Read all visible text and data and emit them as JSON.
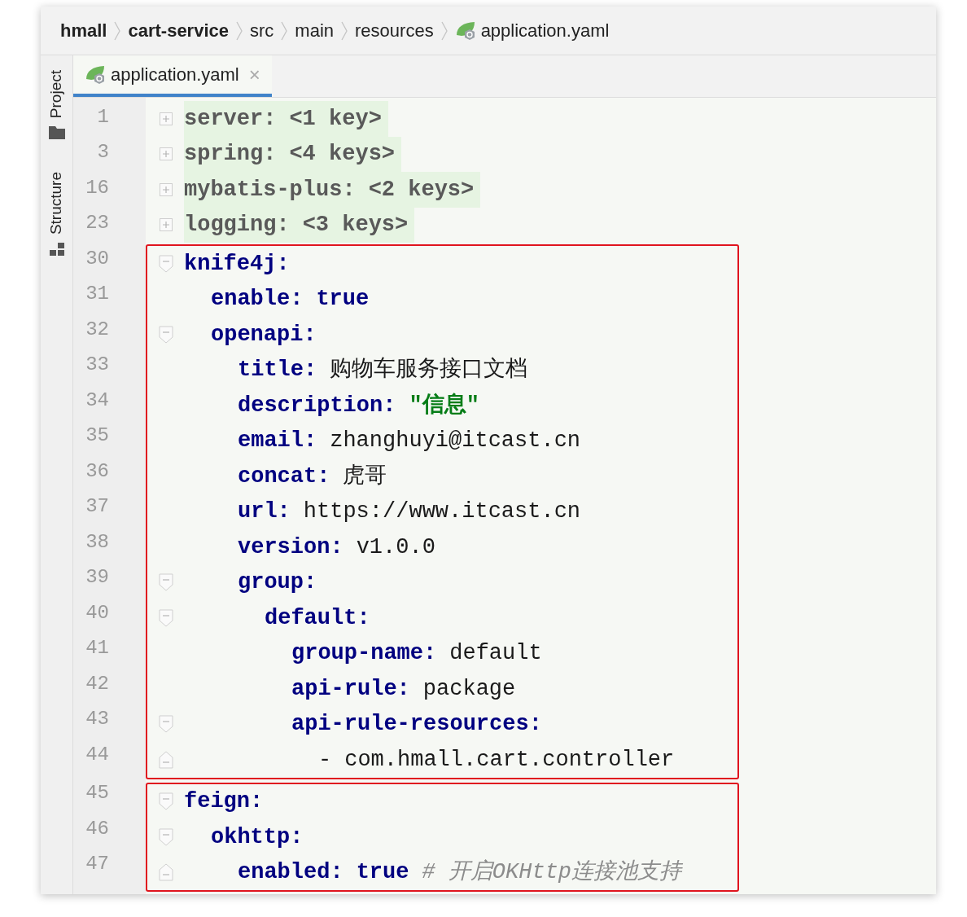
{
  "breadcrumb": [
    {
      "label": "hmall",
      "kind": "module"
    },
    {
      "label": "cart-service",
      "kind": "module"
    },
    {
      "label": "src",
      "kind": "folder"
    },
    {
      "label": "main",
      "kind": "folder"
    },
    {
      "label": "resources",
      "kind": "folder"
    },
    {
      "label": "application.yaml",
      "kind": "file"
    }
  ],
  "tool_strip": [
    {
      "label": "Project",
      "kind": "project"
    },
    {
      "label": "Structure",
      "kind": "structure"
    }
  ],
  "tabs": [
    {
      "label": "application.yaml",
      "selected": true,
      "close": "×"
    }
  ],
  "blocks": [
    {
      "highlighted": false,
      "lines": [
        {
          "number": "1",
          "collapsed": true,
          "key": "server:",
          "value": "<1 key>"
        },
        {
          "number": "3",
          "collapsed": true,
          "key": "spring:",
          "value": "<4 keys>"
        },
        {
          "number": "16",
          "collapsed": true,
          "key": "mybatis-plus:",
          "value": "<2 keys>"
        },
        {
          "number": "23",
          "collapsed": true,
          "key": "logging:",
          "value": "<3 keys>"
        }
      ]
    },
    {
      "highlighted": true,
      "lines": [
        {
          "number": "30",
          "collapsed": false,
          "key": "knife4j:",
          "children": [
            {
              "number": "31",
              "key": "enable:",
              "value": "true",
              "keyword": true
            },
            {
              "number": "32",
              "collapsed": false,
              "key": "openapi:",
              "children": [
                {
                  "number": "33",
                  "key": "title:",
                  "value": "购物车服务接口文档"
                },
                {
                  "number": "34",
                  "key": "description:",
                  "value": "\"信息\"",
                  "quoted": true
                },
                {
                  "number": "35",
                  "key": "email:",
                  "value": "zhanghuyi@itcast.cn"
                },
                {
                  "number": "36",
                  "key": "concat:",
                  "value": "虎哥"
                },
                {
                  "number": "37",
                  "key": "url:",
                  "value": "https://www.itcast.cn"
                },
                {
                  "number": "38",
                  "key": "version:",
                  "value": "v1.0.0"
                },
                {
                  "number": "39",
                  "collapsed": false,
                  "key": "group:",
                  "children": [
                    {
                      "number": "40",
                      "collapsed": false,
                      "key": "default:",
                      "children": [
                        {
                          "number": "41",
                          "key": "group-name:",
                          "value": "default"
                        },
                        {
                          "number": "42",
                          "key": "api-rule:",
                          "value": "package"
                        },
                        {
                          "number": "43",
                          "collapsed": false,
                          "key": "api-rule-resources:",
                          "children": [
                            {
                              "number": "44",
                              "fold_end": true,
                              "marker": "-",
                              "value": "com.hmall.cart.controller"
                            }
                          ]
                        }
                      ]
                    }
                  ]
                }
              ]
            }
          ]
        }
      ]
    },
    {
      "highlighted": true,
      "lines": [
        {
          "number": "45",
          "collapsed": false,
          "key": "feign:",
          "children": [
            {
              "number": "46",
              "collapsed": false,
              "key": "okhttp:",
              "children": [
                {
                  "number": "47",
                  "fold_end": true,
                  "key": "enabled:",
                  "value": "true",
                  "keyword": true,
                  "comment": "# 开启OKHttp连接池支持"
                }
              ]
            }
          ]
        }
      ]
    }
  ]
}
